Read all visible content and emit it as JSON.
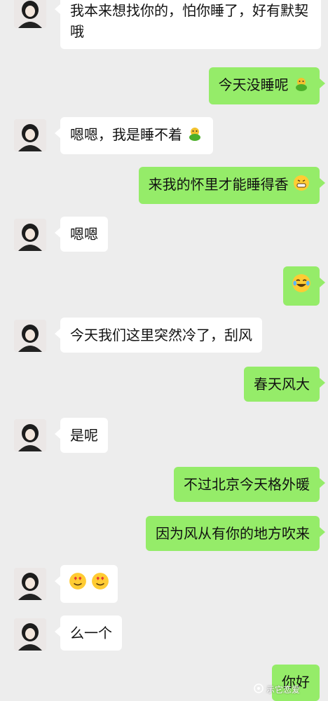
{
  "messages": [
    {
      "side": "in",
      "text": "我本来想找你的，怕你睡了，好有默契哦"
    },
    {
      "side": "out",
      "text": "今天没睡呢",
      "emoji": "frog-icon"
    },
    {
      "side": "in",
      "text": "嗯嗯，我是睡不着",
      "emoji": "frog-icon"
    },
    {
      "side": "out",
      "text": "来我的怀里才能睡得香",
      "emoji": "grin-emoji-icon"
    },
    {
      "side": "in",
      "text": "嗯嗯"
    },
    {
      "side": "out",
      "text": "",
      "emoji": "tears-of-joy-emoji-icon"
    },
    {
      "side": "in",
      "text": "今天我们这里突然冷了，刮风"
    },
    {
      "side": "out",
      "text": "春天风大"
    },
    {
      "side": "in",
      "text": "是呢"
    },
    {
      "side": "out",
      "text": "不过北京今天格外暖"
    },
    {
      "side": "out",
      "text": "因为风从有你的地方吹来"
    },
    {
      "side": "in",
      "text": "",
      "emoji": "heart-eyes-emoji-icon x2"
    },
    {
      "side": "in",
      "text": "么一个"
    },
    {
      "side": "out",
      "text": "你好"
    }
  ],
  "watermark": {
    "text": "示它恋爱",
    "icon": "wechat-channel-icon"
  }
}
